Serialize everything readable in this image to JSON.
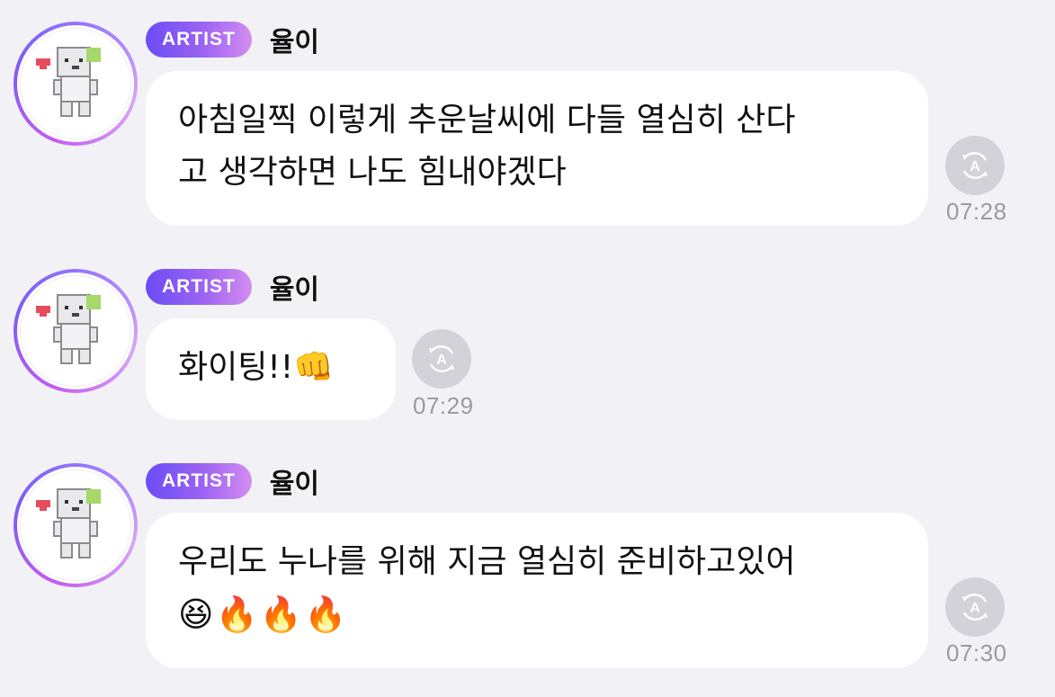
{
  "messages": [
    {
      "badge": "ARTIST",
      "name": "율이",
      "lines": [
        "아침일찍 이렇게 추운날씨에 다들 열심히 산다",
        "고 생각하면 나도 힘내야겠다"
      ],
      "time": "07:28",
      "translate_icon": "translate-icon"
    },
    {
      "badge": "ARTIST",
      "name": "율이",
      "lines": [
        "화이팅!!👊"
      ],
      "time": "07:29",
      "translate_icon": "translate-icon"
    },
    {
      "badge": "ARTIST",
      "name": "율이",
      "lines": [
        "우리도 누나를 위해 지금 열심히 준비하고있어",
        "😆🔥🔥🔥"
      ],
      "time": "07:30",
      "translate_icon": "translate-icon"
    }
  ],
  "colors": {
    "background": "#f2f2f6",
    "bubble": "#ffffff",
    "badge_start": "#6a4cf6",
    "badge_end": "#d38df0",
    "time": "#9a9aa3",
    "translate_button": "#d2d2d8"
  }
}
